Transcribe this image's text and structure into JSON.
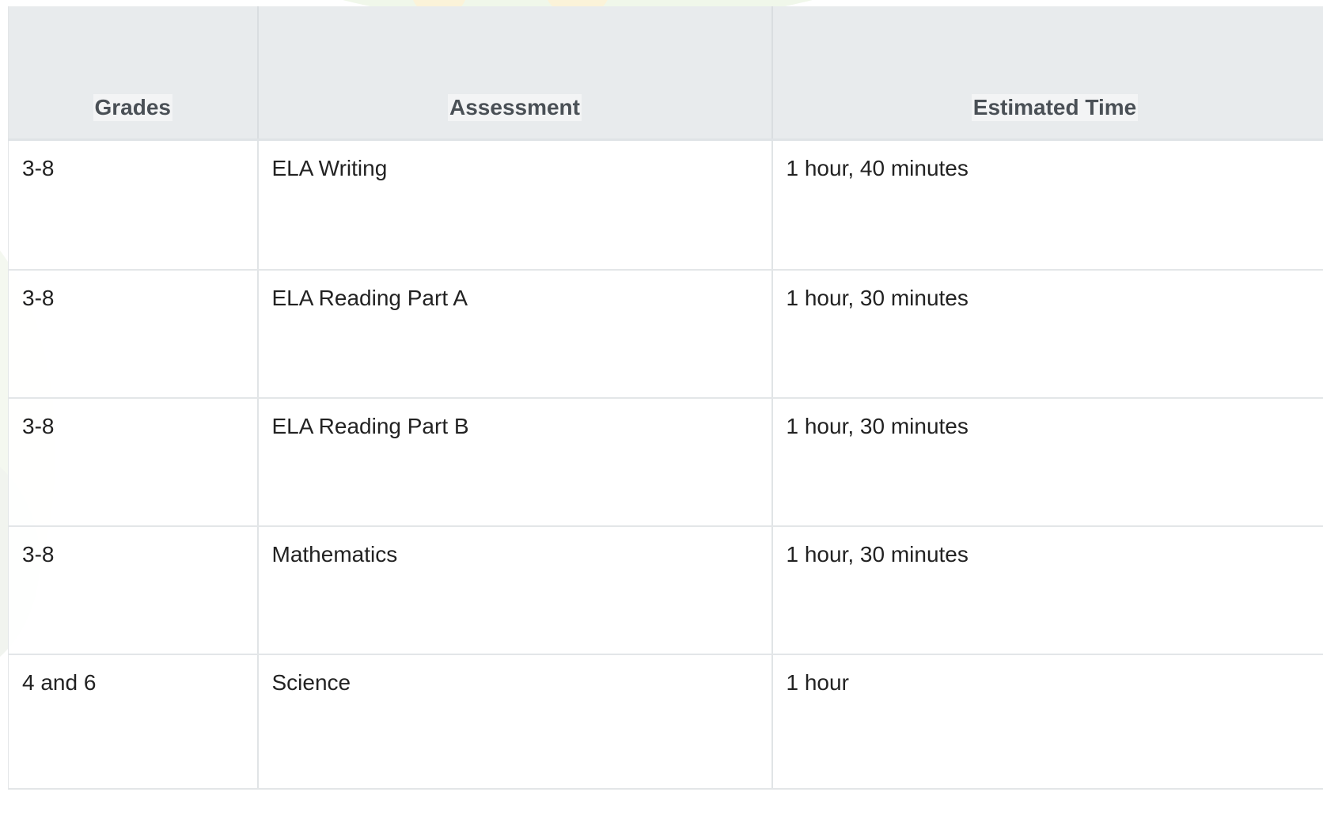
{
  "table": {
    "headers": [
      "Grades",
      "Assessment",
      "Estimated Time"
    ],
    "rows": [
      {
        "grades": "3-8",
        "assessment": "ELA Writing",
        "time": "1 hour, 40 minutes"
      },
      {
        "grades": "3-8",
        "assessment": "ELA Reading Part A",
        "time": "1 hour, 30 minutes"
      },
      {
        "grades": "3-8",
        "assessment": "ELA Reading Part B",
        "time": "1 hour, 30 minutes"
      },
      {
        "grades": "3-8",
        "assessment": "Mathematics",
        "time": "1 hour, 30 minutes"
      },
      {
        "grades": "4 and 6",
        "assessment": "Science",
        "time": "1 hour"
      }
    ]
  },
  "colors": {
    "header_bg": "#e8ebed",
    "header_text": "#4a5056",
    "cell_text": "#222222",
    "border": "#e1e4e6"
  }
}
